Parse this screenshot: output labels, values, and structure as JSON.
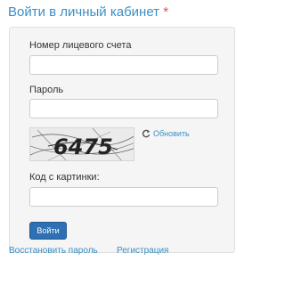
{
  "header": {
    "title": "Войти в личный кабинет",
    "required_mark": "*"
  },
  "form": {
    "account_label": "Номер лицевого счета",
    "account_value": "",
    "password_label": "Пароль",
    "password_value": "",
    "captcha_text": "6475",
    "refresh_label": "Обновить",
    "captcha_code_label": "Код с картинки:",
    "captcha_code_value": "",
    "submit_label": "Войти"
  },
  "links": {
    "restore_password": "Восстановить пароль",
    "register": "Регистрация"
  },
  "colors": {
    "accent": "#3b8fc6",
    "button": "#2f6fb3",
    "panel_bg": "#f5f5f5",
    "required": "#d9534f"
  },
  "icons": {
    "refresh": "refresh-icon"
  }
}
